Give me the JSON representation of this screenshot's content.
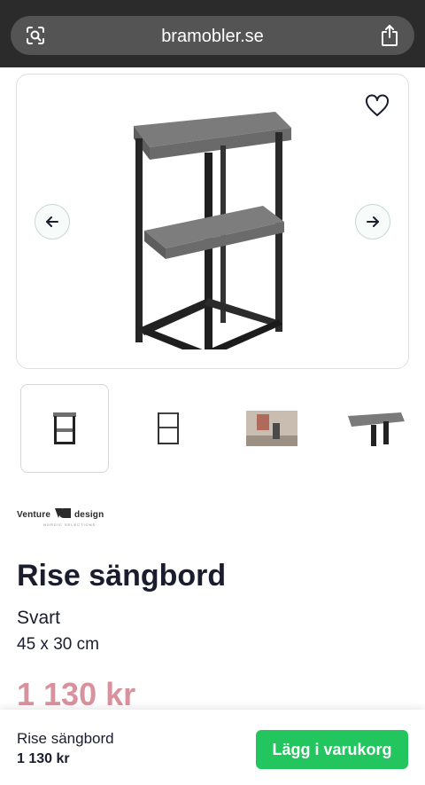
{
  "browser": {
    "url": "bramobler.se",
    "lens_icon": "camera-search-icon",
    "share_icon": "share-icon"
  },
  "gallery": {
    "wishlist_icon": "heart-icon",
    "prev_icon": "arrow-left-icon",
    "next_icon": "arrow-right-icon",
    "thumbnail_count": 4,
    "active_thumbnail": 1
  },
  "product": {
    "brand": {
      "name": "Venture",
      "mark": "design",
      "tagline": "NORDIC SELECTIONS"
    },
    "title": "Rise sängbord",
    "variant": "Svart",
    "dimensions": "45 x 30 cm",
    "price": "1 130 kr"
  },
  "sticky_bar": {
    "name": "Rise sängbord",
    "price": "1 130 kr",
    "cta_label": "Lägg i varukorg"
  },
  "colors": {
    "price": "#d8929d",
    "cta": "#22c55e",
    "text": "#1a1d2e",
    "browser_bar": "#2b2b2b"
  }
}
